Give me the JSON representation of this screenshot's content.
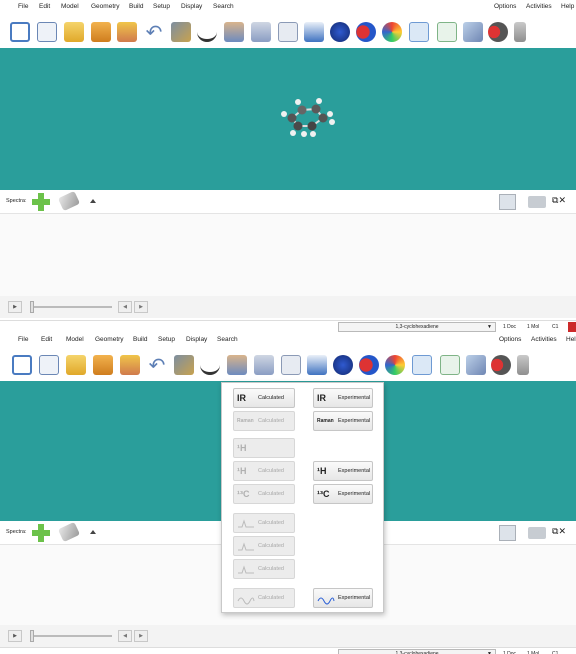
{
  "menu": {
    "file": "File",
    "edit": "Edit",
    "model": "Model",
    "geometry": "Geometry",
    "build": "Build",
    "setup": "Setup",
    "display": "Display",
    "search": "Search",
    "options": "Options",
    "activities": "Activities",
    "help": "Help"
  },
  "toolbar_icons": [
    "new-document-icon",
    "edit-document-icon",
    "open-folder-icon",
    "open-recent-icon",
    "save-icon",
    "undo-icon",
    "build-tools-icon",
    "view-glasses-icon",
    "setup-job-icon",
    "calculation-wizard-icon",
    "surface-icon",
    "document-icon",
    "orbital-icon",
    "molecular-orbitals-icon",
    "potential-map-icon",
    "spectrum-icon",
    "properties-icon",
    "reaction-icon",
    "database-icon",
    "settings-icon"
  ],
  "spectra": {
    "label": "Spectra:"
  },
  "status": {
    "molecule": "1,3-cyclohexadiene",
    "docs": "1 Doc",
    "mols": "1 Mol",
    "symmetry": "C1"
  },
  "popup": {
    "calculated": "Calculated",
    "experimental": "Experimental",
    "ir_glyph": "IR",
    "raman_glyph": "Raman",
    "h1_glyph": "¹H",
    "c13_glyph": "¹³C",
    "uvvis_glyph": "UV/vis"
  },
  "colors": {
    "viewport": "#2a9e9b",
    "plus": "#6cc24a",
    "status_red": "#cc2a2a"
  }
}
